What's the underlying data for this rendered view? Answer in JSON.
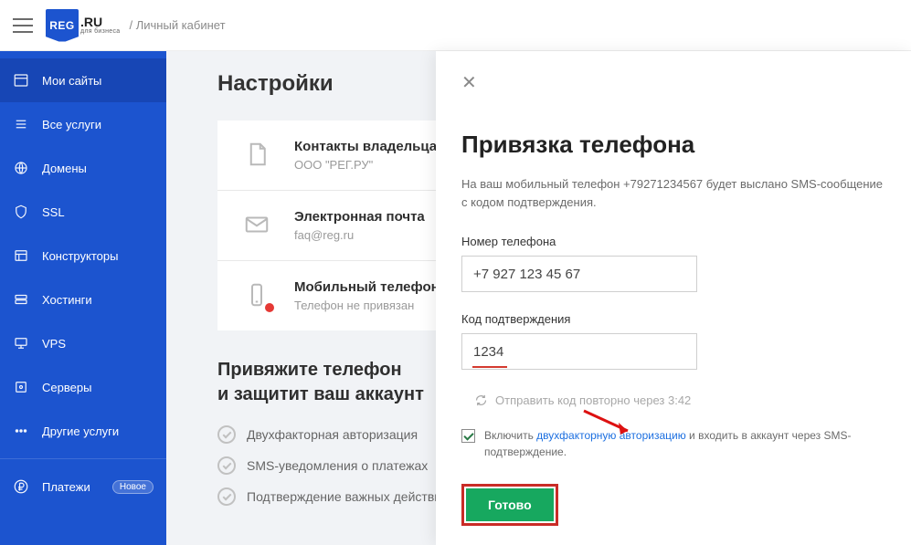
{
  "header": {
    "logo_main": "REG",
    "logo_tld": ".RU",
    "logo_sub": "для бизнеса",
    "breadcrumb": "/ Личный кабинет"
  },
  "sidebar": {
    "items": [
      {
        "icon": "sites-icon",
        "label": "Мои сайты",
        "active": true
      },
      {
        "icon": "list-icon",
        "label": "Все услуги"
      },
      {
        "icon": "globe-icon",
        "label": "Домены"
      },
      {
        "icon": "shield-icon",
        "label": "SSL"
      },
      {
        "icon": "builder-icon",
        "label": "Конструкторы"
      },
      {
        "icon": "host-icon",
        "label": "Хостинги"
      },
      {
        "icon": "vps-icon",
        "label": "VPS"
      },
      {
        "icon": "server-icon",
        "label": "Серверы"
      },
      {
        "icon": "dots-icon",
        "label": "Другие услуги"
      }
    ],
    "payments": {
      "label": "Платежи",
      "badge": "Новое"
    }
  },
  "page": {
    "title": "Настройки",
    "contacts": {
      "title": "Контакты владельца",
      "value": "ООО \"РЕГ.РУ\""
    },
    "email": {
      "title": "Электронная почта",
      "value": "faq@reg.ru"
    },
    "phone": {
      "title": "Мобильный телефон",
      "value": "Телефон не привязан"
    },
    "bind_heading_l1": "Привяжите телефон",
    "bind_heading_l2": "и защитит ваш аккаунт",
    "benefits": [
      "Двухфакторная авторизация",
      "SMS-уведомления о платежах",
      "Подтверждение важных действий"
    ]
  },
  "modal": {
    "title": "Привязка телефона",
    "desc_prefix": "На ваш мобильный телефон ",
    "desc_phone": "+79271234567",
    "desc_suffix": " будет выслано SMS-сообщение с кодом подтверждения.",
    "phone_label": "Номер телефона",
    "phone_value": "+7 927 123 45 67",
    "code_label": "Код подтверждения",
    "code_value": "1234",
    "resend_prefix": "Отправить код повторно через ",
    "resend_time": "3:42",
    "twofa_prefix": "Включить ",
    "twofa_link": "двухфакторную авторизацию",
    "twofa_suffix": " и входить в аккаунт через SMS-подтверждение.",
    "submit": "Готово"
  }
}
